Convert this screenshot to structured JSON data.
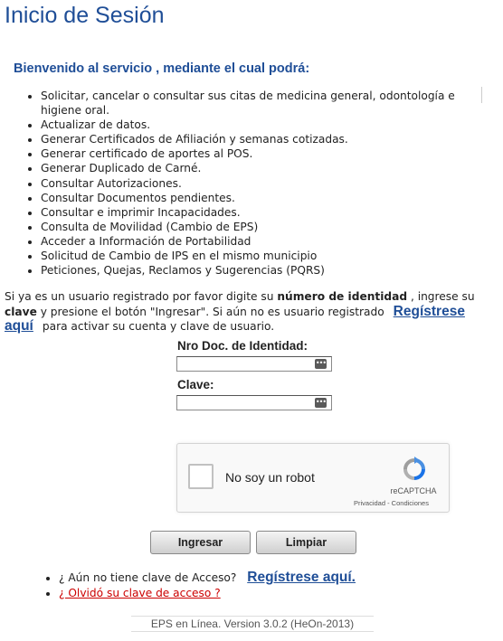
{
  "page": {
    "title": "Inicio de Sesión"
  },
  "welcome": {
    "heading": "Bienvenido al servicio , mediante el cual podrá:",
    "services": [
      "Solicitar, cancelar o consultar sus citas de medicina general, odontología e higiene oral.",
      "Actualizar de datos.",
      "Generar Certificados de Afiliación y semanas cotizadas.",
      "Generar certificado de aportes al POS.",
      "Generar Duplicado de Carné.",
      "Consultar Autorizaciones.",
      "Consultar Documentos pendientes.",
      "Consultar e imprimir Incapacidades.",
      "Consulta de Movilidad (Cambio de EPS)",
      "Acceder a Información de Portabilidad",
      "Solicitud de Cambio de IPS en el mismo municipio",
      "Peticiones, Quejas, Reclamos y Sugerencias (PQRS)"
    ]
  },
  "intro": {
    "part1": "Si ya es un usuario registrado por favor digite su ",
    "bold1": "número de identidad",
    "part2": " , ingrese su ",
    "bold2": "clave",
    "part3": " y presione el botón \"Ingresar\". Si aún no es usuario registrado",
    "register_link": "Regístrese aquí",
    "part4": "para activar su cuenta y clave de usuario."
  },
  "form": {
    "doc_label": "Nro Doc. de Identidad:",
    "doc_value": "",
    "password_label": "Clave:",
    "password_value": ""
  },
  "captcha": {
    "label": "No soy un robot",
    "brand": "reCAPTCHA",
    "links": "Privacidad - Condiciones",
    "icon": "recaptcha-logo"
  },
  "buttons": {
    "login": "Ingresar",
    "clear": "Limpiar"
  },
  "links": {
    "no_key": "¿ Aún no tiene clave de Acceso?",
    "register": "Regístrese aquí.",
    "forgot": "¿ Olvidó su clave de acceso ?"
  },
  "footer": {
    "version": "EPS en Línea. Version 3.0.2 (HeOn-2013)"
  },
  "colors": {
    "accent": "#1f4e97",
    "link_red": "#cc0000"
  }
}
